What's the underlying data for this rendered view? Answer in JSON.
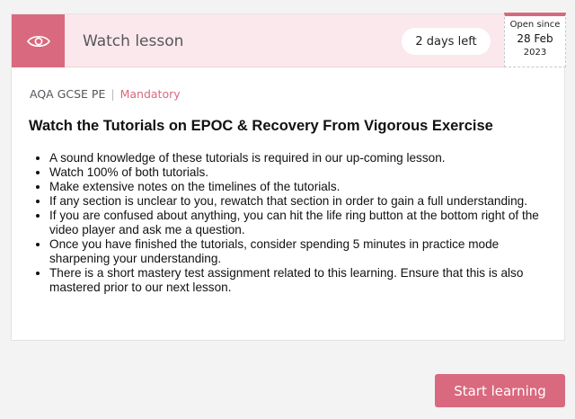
{
  "header": {
    "title": "Watch lesson",
    "icon": "eye-icon",
    "due_badge": "2 days left",
    "open_since": {
      "label": "Open since",
      "date": "28 Feb",
      "year": "2023"
    }
  },
  "meta": {
    "course": "AQA GCSE PE",
    "separator": "|",
    "status": "Mandatory"
  },
  "task": {
    "title": "Watch the Tutorials on EPOC & Recovery From Vigorous Exercise",
    "bullets": [
      "A sound knowledge of these tutorials is required in our up-coming lesson.",
      "Watch 100% of both tutorials.",
      "Make extensive notes on the timelines of the tutorials.",
      "If any section is unclear to you, rewatch that section in order to gain a full understanding.",
      "If you are confused about anything, you can hit the life ring button at the bottom right of the video player and ask me a question.",
      "Once you have finished the tutorials, consider spending 5 minutes in practice mode sharpening your understanding.",
      "There is a short mastery test assignment related to this learning. Ensure that this is also mastered prior to our next lesson."
    ]
  },
  "actions": {
    "start_label": "Start learning"
  },
  "colors": {
    "accent": "#d9697e",
    "header_bg": "#fbe8ec",
    "page_bg": "#f3f3f4"
  }
}
